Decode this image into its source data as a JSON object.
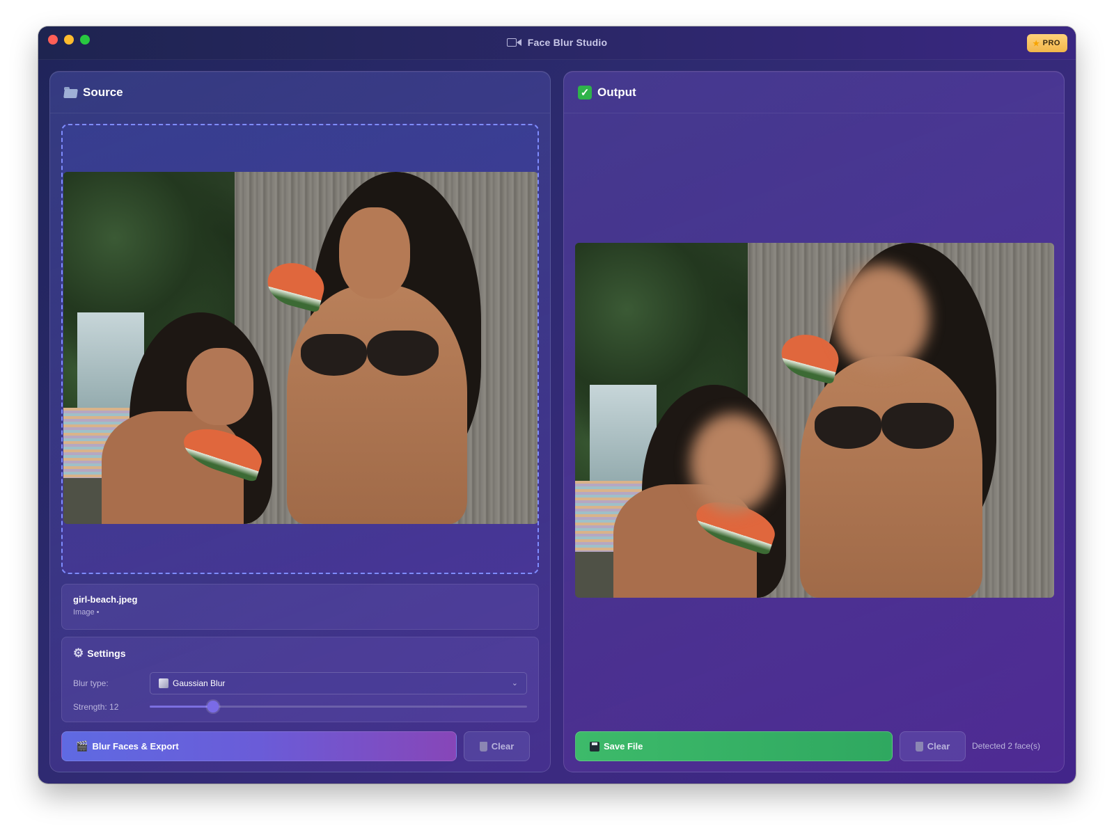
{
  "app": {
    "title": "Face Blur Studio",
    "pro_badge": "PRO"
  },
  "source": {
    "title": "Source",
    "file_name": "girl-beach.jpeg",
    "file_meta": "Image •",
    "settings": {
      "title": "Settings",
      "blur_type_label": "Blur type:",
      "blur_type_value": "Gaussian Blur",
      "strength_label": "Strength: 12",
      "strength_fraction": 0.167
    },
    "blur_button": "Blur Faces & Export",
    "clear_button": "Clear"
  },
  "output": {
    "title": "Output",
    "save_button": "Save File",
    "clear_button": "Clear",
    "status": "Detected 2 face(s)"
  },
  "colors": {
    "accent": "#6a5cd8",
    "save": "#3dba6a",
    "pro": "#f2b64a"
  },
  "icons": [
    "camera-icon",
    "star-icon",
    "folder-icon",
    "check-icon",
    "gear-icon",
    "blur-icon",
    "chevron-down-icon",
    "clapper-icon",
    "trash-icon",
    "floppy-icon"
  ]
}
